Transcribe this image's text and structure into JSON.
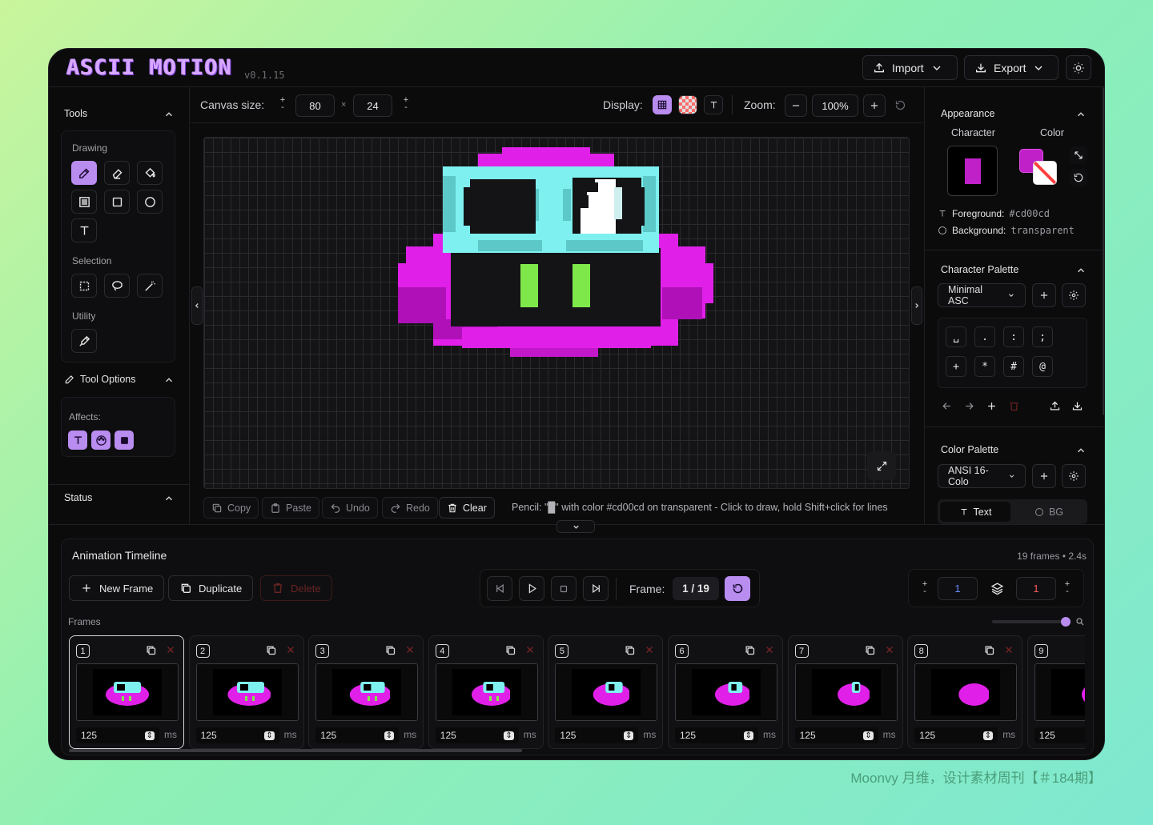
{
  "header": {
    "logo": "ASCII MOTION",
    "version": "v0.1.15",
    "import_label": "Import",
    "export_label": "Export"
  },
  "tools": {
    "section_title": "Tools",
    "drawing_label": "Drawing",
    "selection_label": "Selection",
    "utility_label": "Utility",
    "tool_options_title": "Tool Options",
    "affects_label": "Affects:",
    "status_title": "Status"
  },
  "canvas_toolbar": {
    "canvas_size_label": "Canvas size:",
    "width": "80",
    "times": "×",
    "height": "24",
    "display_label": "Display:",
    "zoom_label": "Zoom:",
    "zoom_value": "100%"
  },
  "actions": {
    "copy": "Copy",
    "paste": "Paste",
    "undo": "Undo",
    "redo": "Redo",
    "clear": "Clear"
  },
  "status_line": "Pencil: \"█\" with color #cd00cd on transparent - Click to draw, hold Shift+click for lines",
  "appearance": {
    "title": "Appearance",
    "character_label": "Character",
    "color_label": "Color",
    "foreground_label": "Foreground:",
    "foreground_value": "#cd00cd",
    "background_label": "Background:",
    "background_value": "transparent",
    "foreground_color": "#c020c8"
  },
  "char_palette": {
    "title": "Character Palette",
    "selected": "Minimal ASC",
    "chars": [
      "␣",
      ".",
      ":",
      ";",
      "+",
      "*",
      "#",
      "@"
    ]
  },
  "color_palette": {
    "title": "Color Palette",
    "selected": "ANSI 16-Colo",
    "tab_text": "Text",
    "tab_bg": "BG"
  },
  "timeline": {
    "title": "Animation Timeline",
    "summary": "19 frames • 2.4s",
    "new_frame": "New Frame",
    "duplicate": "Duplicate",
    "delete": "Delete",
    "frame_label": "Frame:",
    "frame_value": "1 / 19",
    "onion_before": "1",
    "onion_after": "1",
    "frames_label": "Frames",
    "ms_label": "ms",
    "frames": [
      {
        "num": "1",
        "duration": "125"
      },
      {
        "num": "2",
        "duration": "125"
      },
      {
        "num": "3",
        "duration": "125"
      },
      {
        "num": "4",
        "duration": "125"
      },
      {
        "num": "5",
        "duration": "125"
      },
      {
        "num": "6",
        "duration": "125"
      },
      {
        "num": "7",
        "duration": "125"
      },
      {
        "num": "8",
        "duration": "125"
      },
      {
        "num": "9",
        "duration": "125"
      }
    ]
  },
  "watermark": "Moonvy 月维，设计素材周刊【＃184期】",
  "colors": {
    "accent": "#b98cf0",
    "magenta": "#e020e8",
    "cyan": "#7ff0f0",
    "green": "#7ee84a"
  }
}
